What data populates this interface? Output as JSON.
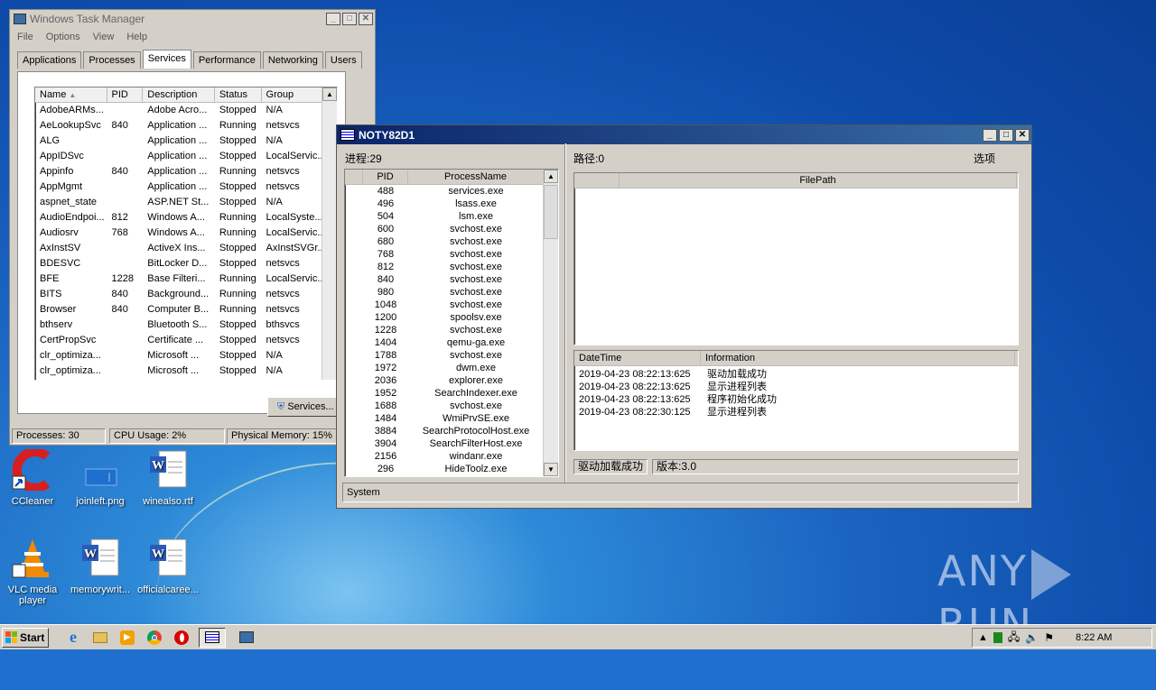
{
  "taskmgr": {
    "title": "Windows Task Manager",
    "menu": [
      "File",
      "Options",
      "View",
      "Help"
    ],
    "tabs": [
      "Applications",
      "Processes",
      "Services",
      "Performance",
      "Networking",
      "Users"
    ],
    "columns": [
      "Name",
      "PID",
      "Description",
      "Status",
      "Group"
    ],
    "rows": [
      [
        "AdobeARMs...",
        "",
        "Adobe Acro...",
        "Stopped",
        "N/A"
      ],
      [
        "AeLookupSvc",
        "840",
        "Application ...",
        "Running",
        "netsvcs"
      ],
      [
        "ALG",
        "",
        "Application ...",
        "Stopped",
        "N/A"
      ],
      [
        "AppIDSvc",
        "",
        "Application ...",
        "Stopped",
        "LocalServic..."
      ],
      [
        "Appinfo",
        "840",
        "Application ...",
        "Running",
        "netsvcs"
      ],
      [
        "AppMgmt",
        "",
        "Application ...",
        "Stopped",
        "netsvcs"
      ],
      [
        "aspnet_state",
        "",
        "ASP.NET St...",
        "Stopped",
        "N/A"
      ],
      [
        "AudioEndpoi...",
        "812",
        "Windows A...",
        "Running",
        "LocalSyste..."
      ],
      [
        "Audiosrv",
        "768",
        "Windows A...",
        "Running",
        "LocalServic..."
      ],
      [
        "AxInstSV",
        "",
        "ActiveX Ins...",
        "Stopped",
        "AxInstSVGr..."
      ],
      [
        "BDESVC",
        "",
        "BitLocker D...",
        "Stopped",
        "netsvcs"
      ],
      [
        "BFE",
        "1228",
        "Base Filteri...",
        "Running",
        "LocalServic..."
      ],
      [
        "BITS",
        "840",
        "Background...",
        "Running",
        "netsvcs"
      ],
      [
        "Browser",
        "840",
        "Computer B...",
        "Running",
        "netsvcs"
      ],
      [
        "bthserv",
        "",
        "Bluetooth S...",
        "Stopped",
        "bthsvcs"
      ],
      [
        "CertPropSvc",
        "",
        "Certificate ...",
        "Stopped",
        "netsvcs"
      ],
      [
        "clr_optimiza...",
        "",
        "Microsoft ...",
        "Stopped",
        "N/A"
      ],
      [
        "clr_optimiza...",
        "",
        "Microsoft ...",
        "Stopped",
        "N/A"
      ]
    ],
    "services_button": "Services...",
    "status": {
      "processes": "Processes: 30",
      "cpu": "CPU Usage: 2%",
      "memory": "Physical Memory: 15%"
    }
  },
  "noty": {
    "title": "NOTY82D1",
    "process_count": "进程:29",
    "path_label": "路径:0",
    "options": "选项",
    "proc_columns": [
      "PID",
      "ProcessName"
    ],
    "processes": [
      [
        "488",
        "services.exe"
      ],
      [
        "496",
        "lsass.exe"
      ],
      [
        "504",
        "lsm.exe"
      ],
      [
        "600",
        "svchost.exe"
      ],
      [
        "680",
        "svchost.exe"
      ],
      [
        "768",
        "svchost.exe"
      ],
      [
        "812",
        "svchost.exe"
      ],
      [
        "840",
        "svchost.exe"
      ],
      [
        "980",
        "svchost.exe"
      ],
      [
        "1048",
        "svchost.exe"
      ],
      [
        "1200",
        "spoolsv.exe"
      ],
      [
        "1228",
        "svchost.exe"
      ],
      [
        "1404",
        "qemu-ga.exe"
      ],
      [
        "1788",
        "svchost.exe"
      ],
      [
        "1972",
        "dwm.exe"
      ],
      [
        "2036",
        "explorer.exe"
      ],
      [
        "1952",
        "SearchIndexer.exe"
      ],
      [
        "1688",
        "svchost.exe"
      ],
      [
        "1484",
        "WmiPrvSE.exe"
      ],
      [
        "3884",
        "SearchProtocolHost.exe"
      ],
      [
        "3904",
        "SearchFilterHost.exe"
      ],
      [
        "2156",
        "windanr.exe"
      ],
      [
        "296",
        "HideToolz.exe"
      ]
    ],
    "filepath_header": "FilePath",
    "log_columns": [
      "DateTime",
      "Information"
    ],
    "log": [
      [
        "2019-04-23 08:22:13:625",
        "驱动加载成功"
      ],
      [
        "2019-04-23 08:22:13:625",
        "显示进程列表"
      ],
      [
        "2019-04-23 08:22:13:625",
        "程序初始化成功"
      ],
      [
        "2019-04-23 08:22:30:125",
        "显示进程列表"
      ]
    ],
    "driver_status": "驱动加载成功",
    "version": "版本:3.0",
    "bottom_status": "System"
  },
  "desktop_icons": [
    {
      "label": "CCleaner",
      "icon": "ccleaner-icon"
    },
    {
      "label": "joinleft.png",
      "icon": "image-file-icon"
    },
    {
      "label": "winealso.rtf",
      "icon": "word-doc-icon"
    },
    {
      "label": "VLC media player",
      "icon": "vlc-icon"
    },
    {
      "label": "memorywrit...",
      "icon": "word-doc-icon"
    },
    {
      "label": "officialcaree...",
      "icon": "word-doc-icon"
    }
  ],
  "watermark": "ANY RUN",
  "taskbar": {
    "start": "Start",
    "clock": "8:22 AM"
  }
}
